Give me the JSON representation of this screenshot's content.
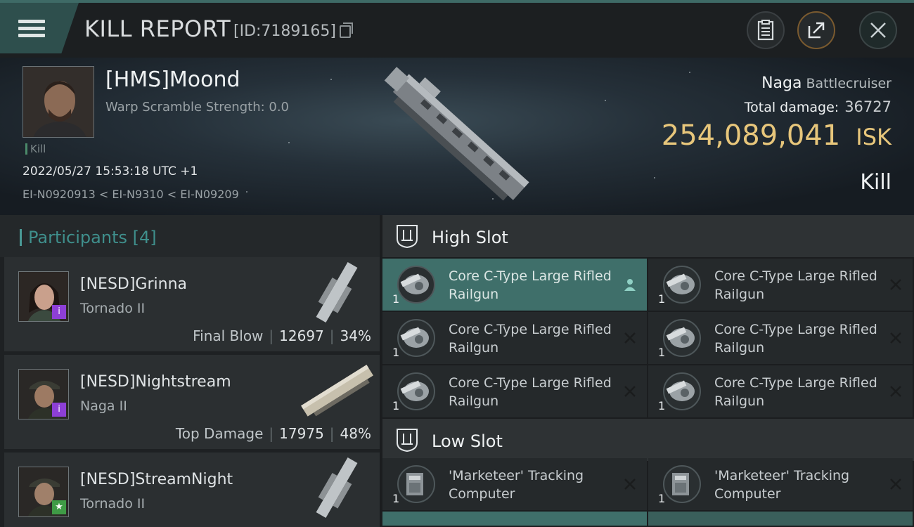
{
  "header": {
    "title": "KILL REPORT",
    "report_id": "[ID:7189165]"
  },
  "victim": {
    "name": "[HMS]Moond",
    "warp_scramble": "Warp Scramble Strength: 0.0",
    "kill_tag": "Kill",
    "timestamp": "2022/05/27 15:53:18 UTC +1",
    "route": "EI-N0920913 < EI-N9310 < EI-N09209",
    "ship_name": "Naga",
    "ship_class": "Battlecruiser",
    "total_damage_label": "Total damage:",
    "total_damage": "36727",
    "isk_value": "254,089,041",
    "isk_unit": "ISK",
    "result": "Kill"
  },
  "participants": {
    "title": "Participants [4]",
    "list": [
      {
        "name": "[NESD]Grinna",
        "ship": "Tornado II",
        "label": "Final Blow",
        "damage": "12697",
        "percent": "34%",
        "badge": "i",
        "badge_color": "#8d3fd6"
      },
      {
        "name": "[NESD]Nightstream",
        "ship": "Naga II",
        "label": "Top Damage",
        "damage": "17975",
        "percent": "48%",
        "badge": "i",
        "badge_color": "#8d3fd6"
      },
      {
        "name": "[NESD]StreamNight",
        "ship": "Tornado II",
        "label": "",
        "damage": "",
        "percent": "",
        "badge": "★",
        "badge_color": "#3f9b46"
      }
    ]
  },
  "slots": {
    "high": {
      "title": "High Slot",
      "items": [
        {
          "qty": "1",
          "name": "Core C-Type Large Rifled Railgun",
          "status": "pilot"
        },
        {
          "qty": "1",
          "name": "Core C-Type Large Rifled Railgun",
          "status": "destroyed"
        },
        {
          "qty": "1",
          "name": "Core C-Type Large Rifled Railgun",
          "status": "destroyed"
        },
        {
          "qty": "1",
          "name": "Core C-Type Large Rifled Railgun",
          "status": "destroyed"
        },
        {
          "qty": "1",
          "name": "Core C-Type Large Rifled Railgun",
          "status": "destroyed"
        },
        {
          "qty": "1",
          "name": "Core C-Type Large Rifled Railgun",
          "status": "destroyed"
        }
      ]
    },
    "low": {
      "title": "Low Slot",
      "items": [
        {
          "qty": "1",
          "name": "'Marketeer' Tracking Computer",
          "status": "destroyed"
        },
        {
          "qty": "1",
          "name": "'Marketeer' Tracking Computer",
          "status": "destroyed"
        }
      ]
    }
  },
  "colors": {
    "accent": "#3f6f6a",
    "isk": "#e7c67b",
    "participants_title": "#3f8f8c"
  }
}
